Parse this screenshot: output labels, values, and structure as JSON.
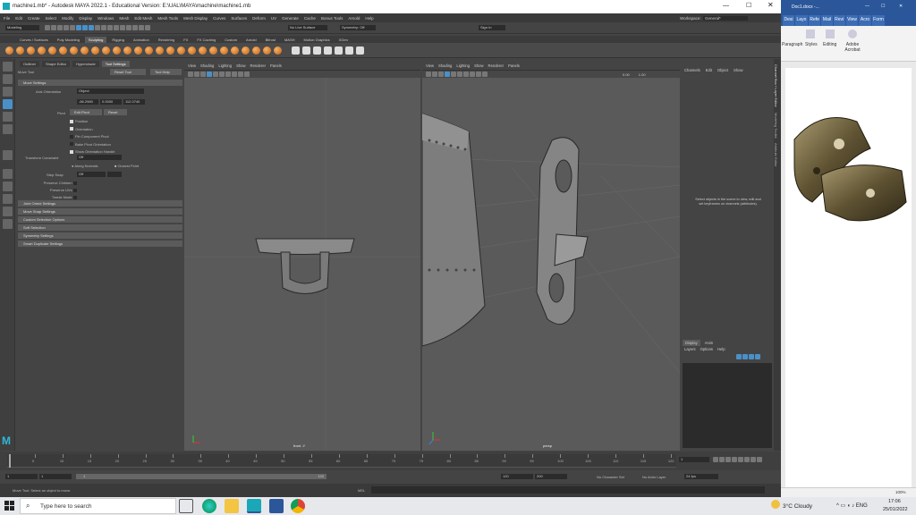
{
  "window": {
    "title": "machine1.mb* - Autodesk MAYA 2022.1 - Educational Version: E:\\UAL\\MAYA\\machine\\machine1.mb"
  },
  "menubar": [
    "File",
    "Edit",
    "Create",
    "Select",
    "Modify",
    "Display",
    "Windows",
    "Mesh",
    "Edit Mesh",
    "Mesh Tools",
    "Mesh Display",
    "Curves",
    "Surfaces",
    "Deform",
    "UV",
    "Generate",
    "Cache",
    "Bonus Tools",
    "Arnold",
    "Help"
  ],
  "workspace": {
    "label": "Workspace:",
    "value": "General*"
  },
  "statusline": {
    "mode": "Modeling",
    "live_surface": "No Live Surface",
    "symmetry": "Symmetry: Off",
    "signin": "Sign In"
  },
  "shelf_tabs": [
    "Curves / Surfaces",
    "Poly Modeling",
    "Sculpting",
    "Rigging",
    "Animation",
    "Rendering",
    "FX",
    "FX Caching",
    "Custom",
    "Arnold",
    "Bifrost",
    "MASH",
    "Motion Graphics",
    "XGen"
  ],
  "shelf_active": "Sculpting",
  "tool_panel": {
    "tabs": [
      "Outliner",
      "Shape Editor",
      "Hypershade",
      "Tool Settings"
    ],
    "active_tab": "Tool Settings",
    "tool_name": "Move Tool",
    "reset_button": "Reset Tool",
    "help_button": "Tool Help",
    "move_settings": "Move Settings",
    "axis_orientation_label": "Axis Orientation",
    "axis_orientation_value": "Object",
    "coords": [
      "-66.2980",
      "0.0000",
      "112.0740"
    ],
    "pivot_label": "Pivot",
    "edit_pivot": "Edit Pivot",
    "reset": "Reset",
    "checkboxes": [
      {
        "label": "Position",
        "on": true
      },
      {
        "label": "Orientation",
        "on": true
      },
      {
        "label": "Pin Component Pivot",
        "on": false
      },
      {
        "label": "Bake Pivot Orientation",
        "on": false
      },
      {
        "label": "Show Orientation Handle",
        "on": true
      }
    ],
    "transform_constraint_label": "Transform Constraint",
    "transform_constraint_value": "Off",
    "along_normals": "Along Normals",
    "closest_point": "Closest Point",
    "step_snap_label": "Step Snap",
    "step_snap_value": "Off",
    "preserve_children": "Preserve Children",
    "preserve_uvs": "Preserve UVs",
    "tweak_mode": "Tweak Mode",
    "sections": [
      "Joint Orient Settings",
      "Move Snap Settings",
      "Custom Selection Options",
      "Soft Selection",
      "Symmetry Settings",
      "Smart Duplicate Settings"
    ]
  },
  "viewport_menu": [
    "View",
    "Shading",
    "Lighting",
    "Show",
    "Renderer",
    "Panels"
  ],
  "viewport_left": {
    "camera": "front -Y"
  },
  "viewport_right": {
    "camera": "persp",
    "value": "0.00",
    "scale": "1.00"
  },
  "channel_box": {
    "menu": [
      "Channels",
      "Edit",
      "Object",
      "Show"
    ],
    "hint": "Select objects in the scene to view, edit and set keyframes on channels (attributes).",
    "layer_tabs": [
      "Display",
      "Anim"
    ],
    "layer_menu": [
      "Layers",
      "Options",
      "Help"
    ]
  },
  "side_tabs": [
    "Channel Box / Layer Editor",
    "Modeling Toolkit",
    "Attribute Editor"
  ],
  "timeline": {
    "ticks": [
      "5",
      "10",
      "15",
      "20",
      "25",
      "30",
      "35",
      "40",
      "45",
      "50",
      "55",
      "60",
      "65",
      "70",
      "75",
      "80",
      "85",
      "90",
      "95",
      "100",
      "105",
      "110",
      "115",
      "120"
    ],
    "current": "1"
  },
  "range": {
    "start": "1",
    "start2": "1",
    "inner": "1",
    "inner_end": "120",
    "end": "120",
    "end2": "200",
    "character_set": "No Character Set",
    "anim_layer": "No Anim Layer",
    "fps": "24 fps"
  },
  "helpline": {
    "mel": "MEL",
    "message": "Move Tool: Select an object to move."
  },
  "word": {
    "title": "Doc1.docx -...",
    "tabs": [
      "Desi",
      "Layo",
      "Refe",
      "Mail",
      "Revi",
      "View",
      "Acro",
      "Form"
    ],
    "ribbon": [
      "Paragraph",
      "Styles",
      "Editing",
      "Adobe Acrobat"
    ],
    "zoom": "100%"
  },
  "taskbar": {
    "search_placeholder": "Type here to search",
    "weather": "3°C  Cloudy",
    "time": "17:06",
    "date": "25/01/2022"
  },
  "colors": {
    "maya_bg": "#444444",
    "viewport": "#5a5a5a",
    "accent_blue": "#4a90c8",
    "shelf_orange": "#e8822a",
    "word_blue": "#2b579a"
  }
}
